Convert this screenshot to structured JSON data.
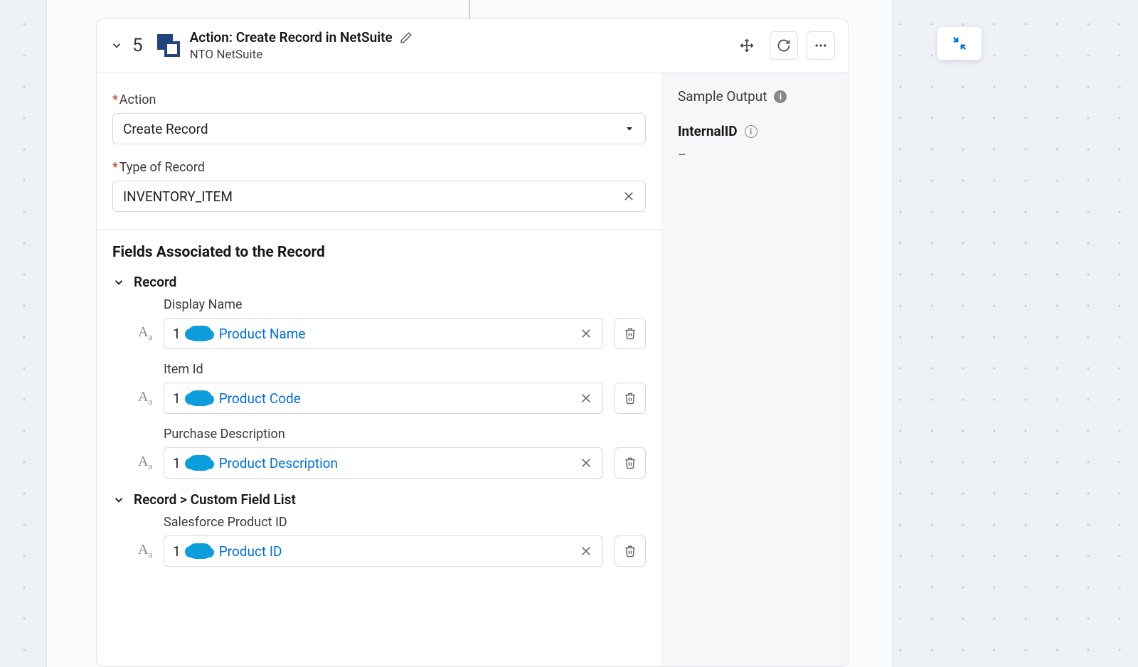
{
  "step": {
    "number": "5",
    "title": "Action: Create Record in NetSuite",
    "subtitle": "NTO NetSuite"
  },
  "form": {
    "action_label": "Action",
    "action_value": "Create Record",
    "type_label": "Type of Record",
    "type_value": "INVENTORY_ITEM",
    "section_title": "Fields Associated to the Record",
    "groups": [
      {
        "label": "Record",
        "fields": [
          {
            "name": "Display Name",
            "pill_num": "1",
            "pill_text": "Product Name"
          },
          {
            "name": "Item Id",
            "pill_num": "1",
            "pill_text": "Product Code"
          },
          {
            "name": "Purchase Description",
            "pill_num": "1",
            "pill_text": "Product Description"
          }
        ]
      },
      {
        "label": "Record > Custom Field List",
        "fields": [
          {
            "name": "Salesforce Product ID",
            "pill_num": "1",
            "pill_text": "Product ID"
          }
        ]
      }
    ]
  },
  "sample": {
    "title": "Sample Output",
    "outputs": [
      {
        "name": "InternalID",
        "value": "–"
      }
    ]
  }
}
